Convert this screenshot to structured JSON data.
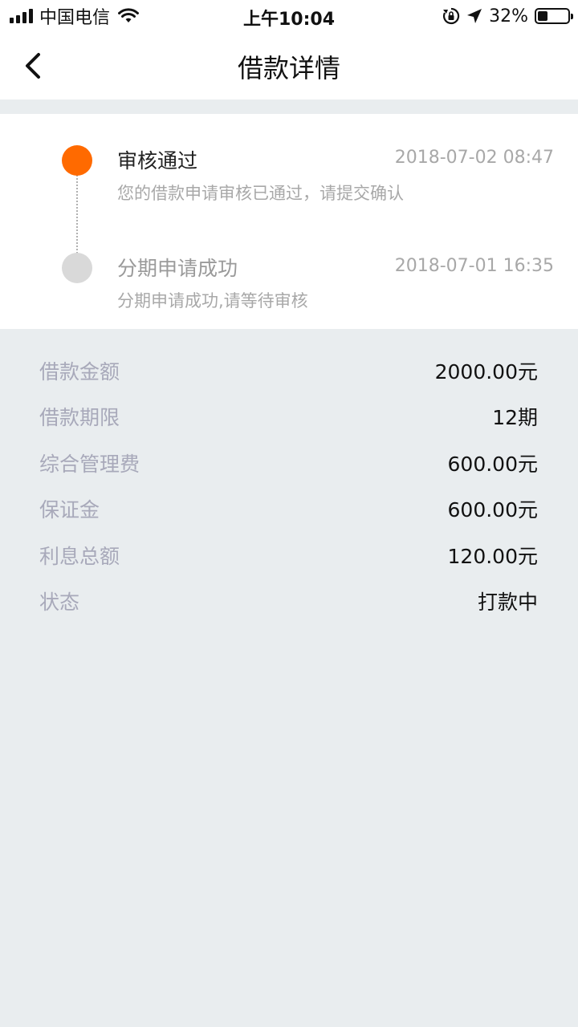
{
  "status_bar": {
    "carrier": "中国电信",
    "time": "上午10:04",
    "battery": "32%",
    "battery_level": 0.32
  },
  "nav": {
    "title": "借款详情"
  },
  "timeline": [
    {
      "title": "审核通过",
      "time": "2018-07-02 08:47",
      "desc": "您的借款申请审核已通过，请提交确认"
    },
    {
      "title": "分期申请成功",
      "time": "2018-07-01 16:35",
      "desc": "分期申请成功,请等待审核"
    }
  ],
  "details": [
    {
      "label": "借款金额",
      "value": "2000.00元"
    },
    {
      "label": "借款期限",
      "value": "12期"
    },
    {
      "label": "综合管理费",
      "value": "600.00元"
    },
    {
      "label": "保证金",
      "value": "600.00元"
    },
    {
      "label": "利息总额",
      "value": "120.00元"
    },
    {
      "label": "状态",
      "value": "打款中"
    }
  ],
  "colors": {
    "accent": "#ff6a00",
    "inactive_dot": "#d9d9d9",
    "page_bg": "#e9edef",
    "label_text": "#a8a9ba"
  }
}
